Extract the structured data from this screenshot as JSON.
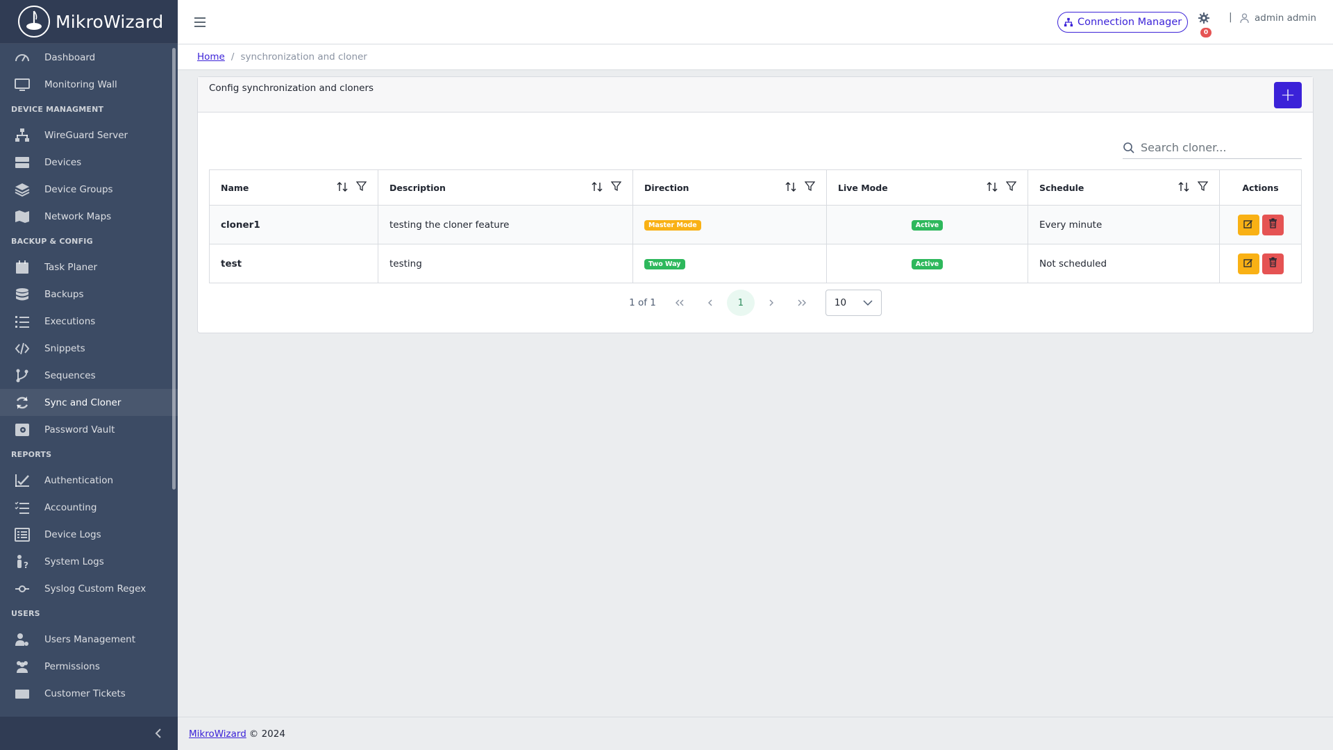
{
  "brand": {
    "name": "MikroWizard"
  },
  "sidebar": {
    "sections": [
      {
        "title": "",
        "items": [
          {
            "label": "Dashboard",
            "icon": "speedometer-icon"
          },
          {
            "label": "Monitoring Wall",
            "icon": "monitor-icon"
          }
        ]
      },
      {
        "title": "DEVICE MANAGMENT",
        "items": [
          {
            "label": "WireGuard Server",
            "icon": "network-icon"
          },
          {
            "label": "Devices",
            "icon": "storage-icon"
          },
          {
            "label": "Device Groups",
            "icon": "layers-icon"
          },
          {
            "label": "Network Maps",
            "icon": "map-icon"
          }
        ]
      },
      {
        "title": "BACKUP & CONFIG",
        "items": [
          {
            "label": "Task Planer",
            "icon": "calendar-icon"
          },
          {
            "label": "Backups",
            "icon": "database-icon"
          },
          {
            "label": "Executions",
            "icon": "task-list-icon"
          },
          {
            "label": "Snippets",
            "icon": "code-icon"
          },
          {
            "label": "Sequences",
            "icon": "fork-icon"
          },
          {
            "label": "Sync and Cloner",
            "icon": "sync-icon",
            "active": true
          },
          {
            "label": "Password Vault",
            "icon": "vault-icon"
          }
        ]
      },
      {
        "title": "REPORTS",
        "items": [
          {
            "label": "Authentication",
            "icon": "check-chart-icon"
          },
          {
            "label": "Accounting",
            "icon": "list-check-icon"
          },
          {
            "label": "Device Logs",
            "icon": "logs-icon"
          },
          {
            "label": "System Logs",
            "icon": "person-question-icon"
          },
          {
            "label": "Syslog Custom Regex",
            "icon": "commit-icon"
          }
        ]
      },
      {
        "title": "USERS",
        "items": [
          {
            "label": "Users Management",
            "icon": "user-gear-icon"
          },
          {
            "label": "Permissions",
            "icon": "people-icon"
          },
          {
            "label": "Customer Tickets",
            "icon": "ticket-icon"
          }
        ]
      }
    ]
  },
  "header": {
    "connection_manager": "Connection Manager",
    "notification_count": "0",
    "separator": "|",
    "user": "admin admin"
  },
  "breadcrumb": {
    "home": "Home",
    "separator": "/",
    "current": "synchronization and cloner"
  },
  "card": {
    "title": "Config synchronization and cloners",
    "add_label": "+",
    "search_placeholder": "Search cloner..."
  },
  "table": {
    "columns": [
      "Name",
      "Description",
      "Direction",
      "Live Mode",
      "Schedule",
      "Actions"
    ],
    "rows": [
      {
        "name": "cloner1",
        "description": "testing the cloner feature",
        "direction": "Master Mode",
        "live_mode": "Active",
        "schedule": "Every minute"
      },
      {
        "name": "test",
        "description": "testing",
        "direction": "Two Way",
        "live_mode": "Active",
        "schedule": "Not scheduled"
      }
    ]
  },
  "pagination": {
    "info": "1 of 1",
    "current_page": "1",
    "page_size": "10"
  },
  "footer": {
    "link": "MikroWizard",
    "text": "© 2024"
  },
  "colors": {
    "primary": "#3b22d8",
    "sidebar": "#3c4b64",
    "warning": "#f9b115",
    "success": "#2eb85c",
    "danger": "#e55353"
  }
}
